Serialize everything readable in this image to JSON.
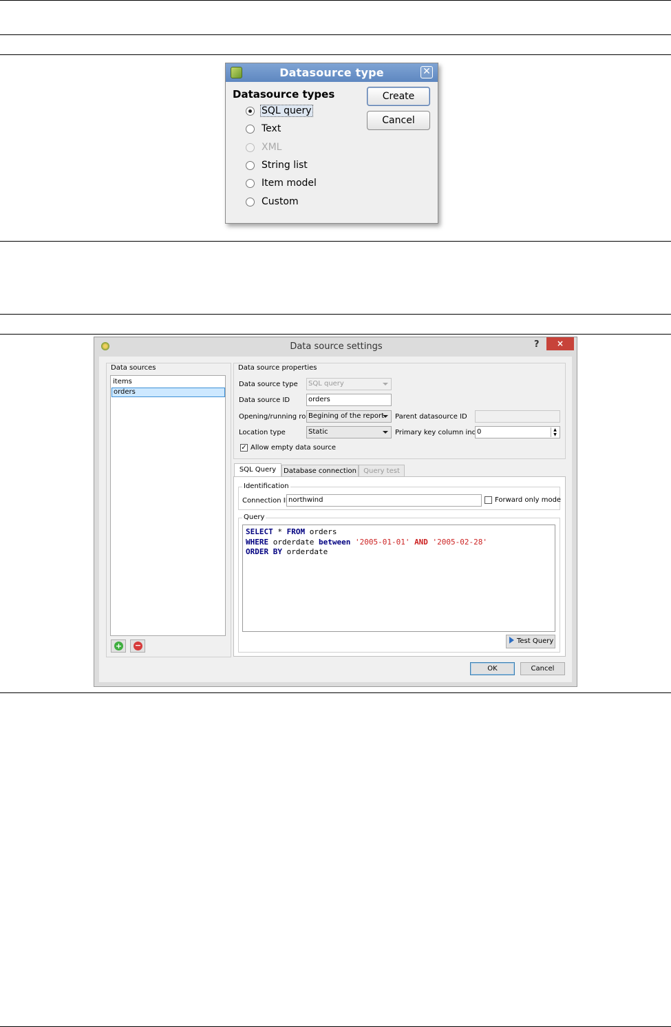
{
  "datasource_type_dialog": {
    "title": "Datasource type",
    "group_title": "Datasource types",
    "options": [
      {
        "label": "SQL query",
        "checked": true,
        "enabled": true
      },
      {
        "label": "Text",
        "checked": false,
        "enabled": true
      },
      {
        "label": "XML",
        "checked": false,
        "enabled": false
      },
      {
        "label": "String list",
        "checked": false,
        "enabled": true
      },
      {
        "label": "Item model",
        "checked": false,
        "enabled": true
      },
      {
        "label": "Custom",
        "checked": false,
        "enabled": true
      }
    ],
    "create_label": "Create",
    "cancel_label": "Cancel",
    "title_bar_color": "#6a91c8"
  },
  "settings_dialog": {
    "title": "Data source settings",
    "help_label": "?",
    "close_label": "×",
    "data_sources": {
      "group_title": "Data sources",
      "items": [
        "items",
        "orders"
      ],
      "selected": "orders"
    },
    "properties": {
      "group_title": "Data source properties",
      "type_label": "Data source type",
      "type_value": "SQL query",
      "id_label": "Data source ID",
      "id_value": "orders",
      "role_label": "Opening/running role",
      "role_value": "Begining of the report",
      "parent_label": "Parent datasource ID",
      "parent_value": "",
      "location_label": "Location type",
      "location_value": "Static",
      "pk_label": "Primary key column index",
      "pk_value": "0",
      "allow_empty_label": "Allow empty data source",
      "allow_empty_checked": true
    },
    "tabs": [
      {
        "label": "SQL Query",
        "active": true,
        "enabled": true
      },
      {
        "label": "Database connection",
        "active": false,
        "enabled": true
      },
      {
        "label": "Query test",
        "active": false,
        "enabled": false
      }
    ],
    "identification": {
      "group_title": "Identification",
      "connection_label": "Connection ID",
      "connection_value": "northwind",
      "forward_only_label": "Forward only mode",
      "forward_only_checked": false
    },
    "query": {
      "group_title": "Query",
      "line1_kw1": "SELECT",
      "line1_rest": " * ",
      "line1_kw2": "FROM",
      "line1_tail": " orders",
      "line2_kw1": "WHERE",
      "line2_mid": " orderdate ",
      "line2_kw2": "between",
      "line2_str1": " '2005-01-01' ",
      "line2_op": "AND",
      "line2_str2": " '2005-02-28'",
      "line3_kw": "ORDER BY",
      "line3_tail": " orderdate"
    },
    "test_query_label": "Test Query",
    "ok_label": "OK",
    "cancel_label": "Cancel"
  }
}
